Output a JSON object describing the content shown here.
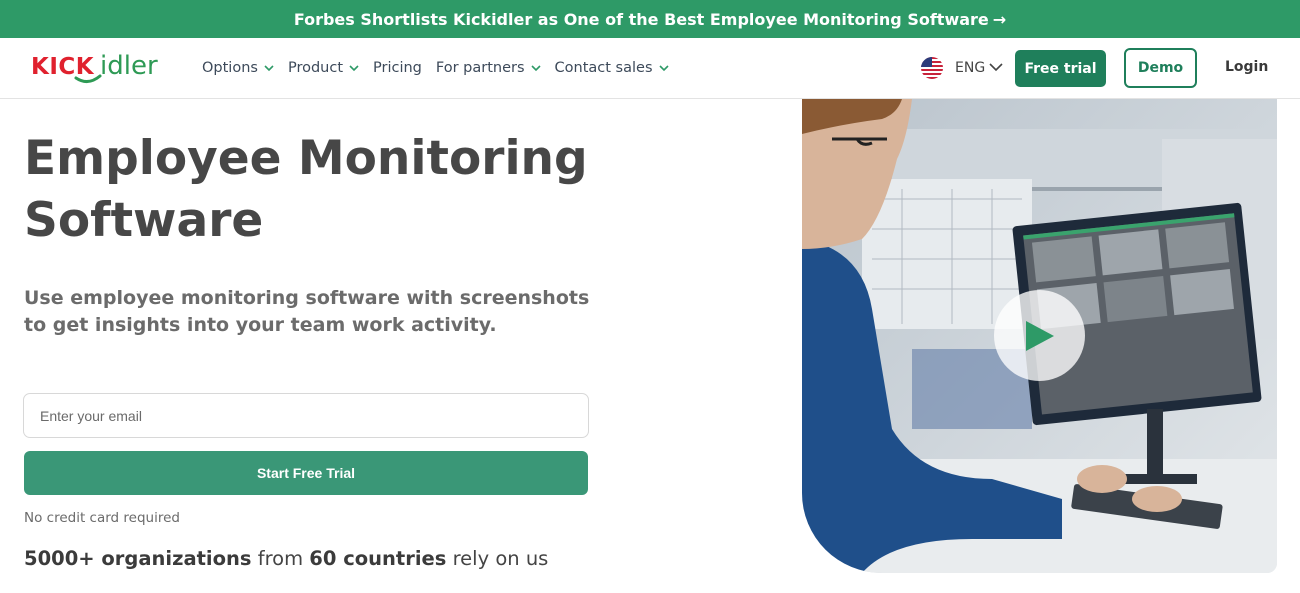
{
  "banner": {
    "text": "Forbes Shortlists Kickidler as One of the Best Employee Monitoring Software",
    "arrow": "→"
  },
  "header": {
    "logo": {
      "text": "kickidler",
      "red_part": "KICK",
      "green_part": "idler"
    },
    "nav": [
      {
        "label": "Options",
        "has_dropdown": true
      },
      {
        "label": "Product",
        "has_dropdown": true
      },
      {
        "label": "Pricing",
        "has_dropdown": false
      },
      {
        "label": "For partners",
        "has_dropdown": true
      },
      {
        "label": "Contact sales",
        "has_dropdown": true
      }
    ],
    "language": {
      "label": "ENG",
      "flag": "us-flag-icon"
    },
    "free_trial_label": "Free trial",
    "demo_label": "Demo",
    "login_label": "Login"
  },
  "hero": {
    "title_line1": "Employee Monitoring",
    "title_line2": "Software",
    "subtitle": "Use employee monitoring software with screenshots to get insights into your team work activity.",
    "email_placeholder": "Enter your email",
    "email_value": "",
    "cta_label": "Start Free Trial",
    "note": "No credit card required",
    "rely": {
      "part1_bold": "5000+ organizations",
      "part2": " from ",
      "part3_bold": "60 countries",
      "part4": " rely on us"
    },
    "media": {
      "icon": "play-icon"
    }
  },
  "colors": {
    "banner": "#2e9a67",
    "primary": "#1f7f5b",
    "cta": "#3a9777",
    "logo_red": "#e0212e",
    "logo_green": "#2e9a55"
  }
}
